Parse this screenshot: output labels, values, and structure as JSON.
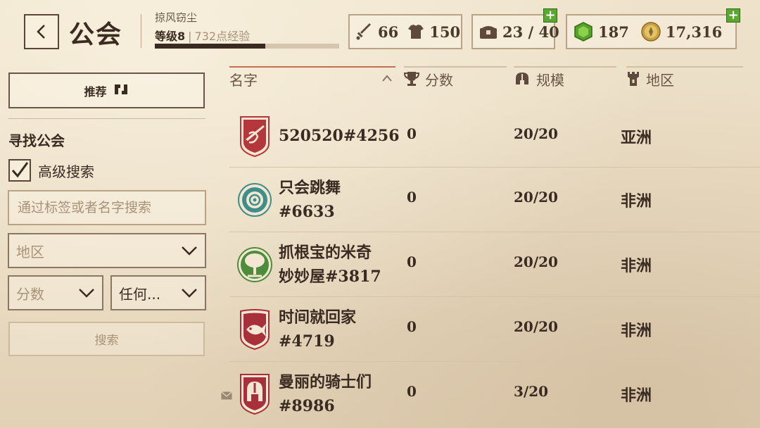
{
  "header": {
    "title": "公会",
    "player_name": "掠风窃尘",
    "level_label": "等级8",
    "xp_label": "732点经验",
    "xp_progress": 0.6,
    "attack": "66",
    "defense": "150",
    "inventory": "23 / 40",
    "gems": "187",
    "gold": "17,316"
  },
  "sidebar": {
    "recommend_label": "推荐",
    "find_title": "寻找公会",
    "advanced_label": "高级搜索",
    "advanced_checked": true,
    "search_placeholder": "通过标签或者名字搜索",
    "region_select": "地区",
    "score_select": "分数",
    "any_select": "任何...",
    "search_button": "搜索"
  },
  "table": {
    "columns": {
      "name": "名字",
      "score": "分数",
      "size": "规模",
      "region": "地区"
    },
    "rows": [
      {
        "name_line1": "520520#4256",
        "name_line2": "",
        "score": "0",
        "size": "20/20",
        "region": "亚洲",
        "emblem": "red-rifle-banner",
        "emblem_color": "#b3373b"
      },
      {
        "name_line1": "只会跳舞",
        "name_line2": "#6633",
        "score": "0",
        "size": "20/20",
        "region": "非洲",
        "emblem": "teal-rose-banner",
        "emblem_color": "#3f8f88"
      },
      {
        "name_line1": "抓根宝的米奇",
        "name_line2": "妙妙屋#3817",
        "score": "0",
        "size": "20/20",
        "region": "非洲",
        "emblem": "green-tree-banner",
        "emblem_color": "#4c8c3a"
      },
      {
        "name_line1": "时间就回家",
        "name_line2": "#4719",
        "score": "0",
        "size": "20/20",
        "region": "非洲",
        "emblem": "red-fish-banner",
        "emblem_color": "#a8303a"
      },
      {
        "name_line1": "曼丽的骑士们",
        "name_line2": "#8986",
        "score": "0",
        "size": "3/20",
        "region": "非洲",
        "emblem": "red-helmet-banner",
        "emblem_color": "#a8303a"
      }
    ]
  },
  "colors": {
    "accent_green": "#5aa830",
    "sort_underline": "#c2704e",
    "text_dark": "#3a2b22"
  }
}
